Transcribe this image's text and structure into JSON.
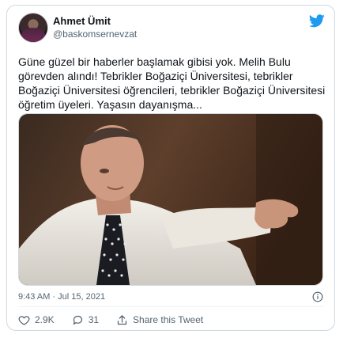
{
  "tweet": {
    "author_name": "Ahmet Ümit",
    "author_handle": "@baskomsernevzat",
    "text": "Güne güzel bir haberler başlamak gibisi yok. Melih Bulu görevden alındı! Tebrikler Boğaziçi Üniversitesi, tebrikler Boğaziçi Üniversitesi öğrencileri, tebrikler Boğaziçi Üniversitesi öğretim üyeleri. Yaşasın dayanışma...",
    "timestamp": "9:43 AM · Jul 15, 2021",
    "likes": "2.9K",
    "replies": "31",
    "share_label": "Share this Tweet"
  },
  "icons": {
    "brand": "twitter-bird-icon",
    "info": "info-icon",
    "like": "heart-icon",
    "reply": "reply-icon",
    "share": "share-icon"
  },
  "colors": {
    "twitter_blue": "#1d9bf0",
    "muted_text": "#536471",
    "border": "#cfd9de"
  }
}
